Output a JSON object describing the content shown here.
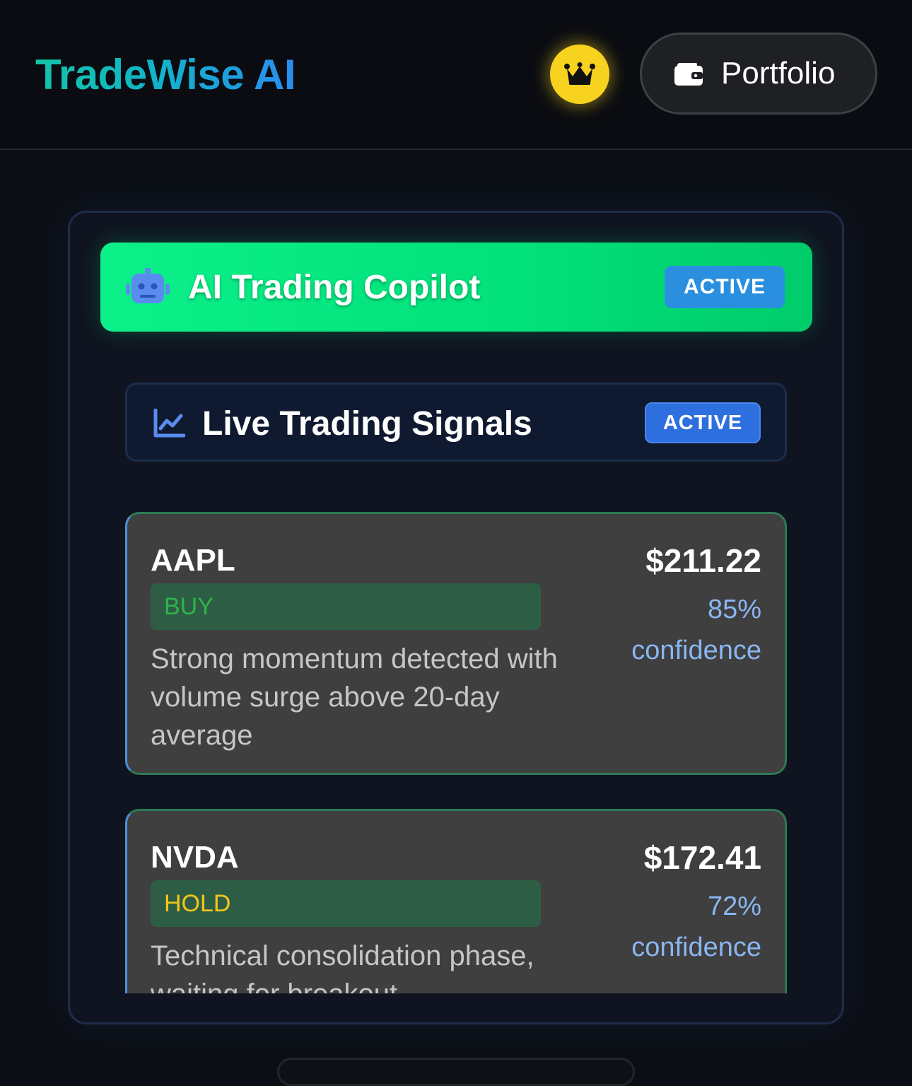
{
  "header": {
    "app_title": "TradeWise AI",
    "portfolio_label": "Portfolio"
  },
  "copilot": {
    "title": "AI Trading Copilot",
    "status": "ACTIVE"
  },
  "signals": {
    "title": "Live Trading Signals",
    "status": "ACTIVE",
    "items": [
      {
        "ticker": "AAPL",
        "action": "BUY",
        "action_color": "#2fb34a",
        "reason": "Strong momentum detected with volume surge above 20-day average",
        "price": "$211.22",
        "confidence_pct": "85%",
        "confidence_label": "confidence"
      },
      {
        "ticker": "NVDA",
        "action": "HOLD",
        "action_color": "#f5c518",
        "reason": "Technical consolidation phase, waiting for breakout",
        "price": "$172.41",
        "confidence_pct": "72%",
        "confidence_label": "confidence"
      }
    ]
  },
  "colors": {
    "accent_green": "#02e07a",
    "accent_blue": "#2e6fe0",
    "crown_yellow": "#f7d21f",
    "card_bg": "#3f3f3f"
  },
  "icons": {
    "crown": "crown-icon",
    "wallet": "wallet-icon",
    "robot": "robot-icon",
    "chart": "chart-line-icon"
  }
}
